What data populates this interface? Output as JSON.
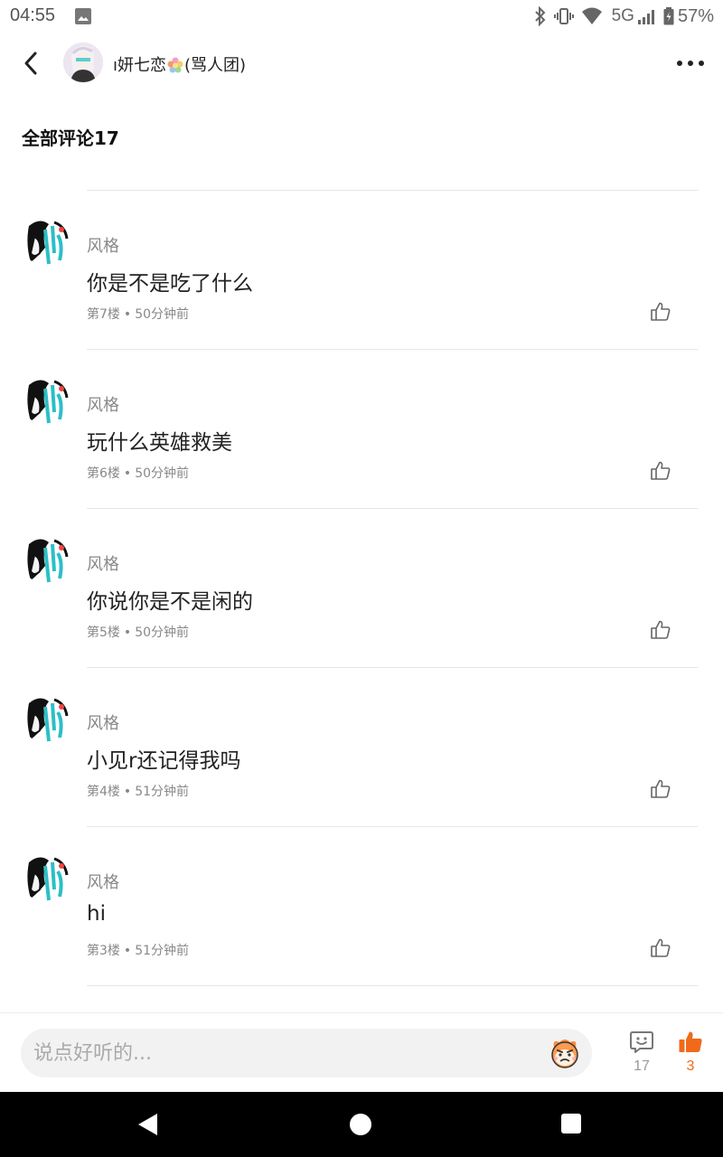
{
  "status_bar": {
    "time": "04:55",
    "network": "5G",
    "battery": "57%",
    "icons": [
      "image-icon",
      "bluetooth-icon",
      "vibrate-icon",
      "wifi-icon",
      "signal-icon",
      "battery-icon"
    ]
  },
  "header": {
    "title_prefix": "ı妍七恋",
    "title_suffix": "(骂人团)",
    "icons": [
      "back-arrow-icon",
      "flower-emoji-icon",
      "more-dots-icon"
    ]
  },
  "section": {
    "title": "全部评论17"
  },
  "comments": [
    {
      "username": "风格",
      "content": "你是不是吃了什么",
      "floor": "第7楼",
      "time": "50分钟前"
    },
    {
      "username": "风格",
      "content": "玩什么英雄救美",
      "floor": "第6楼",
      "time": "50分钟前"
    },
    {
      "username": "风格",
      "content": "你说你是不是闲的",
      "floor": "第5楼",
      "time": "50分钟前"
    },
    {
      "username": "风格",
      "content": "小见r还记得我吗",
      "floor": "第4楼",
      "time": "51分钟前"
    },
    {
      "username": "风格",
      "content": "hi",
      "floor": "第3楼",
      "time": "51分钟前"
    }
  ],
  "meta_separator": "•",
  "bottom_bar": {
    "input_placeholder": "说点好听的...",
    "comment_count": "17",
    "like_count": "3",
    "icons": [
      "emoji-face-icon",
      "comment-bubble-icon",
      "thumbs-up-filled-icon"
    ]
  },
  "colors": {
    "accent": "#f06a1a",
    "text_primary": "#222222",
    "text_secondary": "#888888",
    "divider": "#e6e6e6",
    "input_bg": "#f2f2f2"
  }
}
